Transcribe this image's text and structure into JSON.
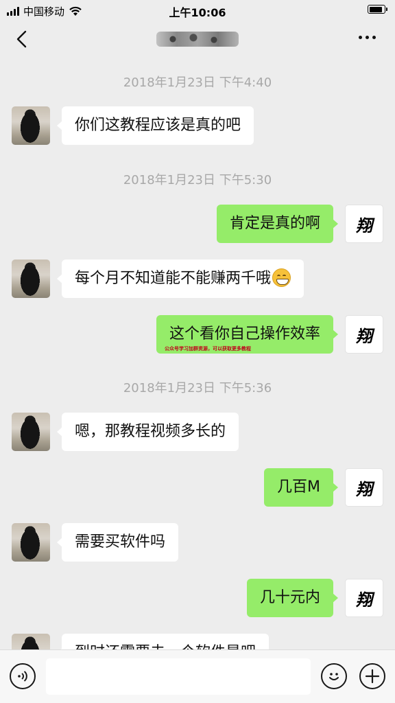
{
  "status_bar": {
    "carrier": "中国移动",
    "time": "上午10:06",
    "battery_level": 0.9
  },
  "nav": {
    "back_icon": "chevron-left-icon",
    "more_icon": "ellipsis-icon"
  },
  "messages": [
    {
      "type": "timestamp",
      "text": "2018年1月23日 下午4:40"
    },
    {
      "type": "msg",
      "side": "left",
      "text": "你们这教程应该是真的吧"
    },
    {
      "type": "timestamp",
      "text": "2018年1月23日 下午5:30"
    },
    {
      "type": "msg",
      "side": "right",
      "text": "肯定是真的啊"
    },
    {
      "type": "msg",
      "side": "left",
      "text": "每个月不知道能不能赚两千哦",
      "emoji": "grin-emoji"
    },
    {
      "type": "msg",
      "side": "right",
      "text": "这个看你自己操作效率",
      "overlay": "公众号学习加群资源，可以获取更多教程"
    },
    {
      "type": "timestamp",
      "text": "2018年1月23日 下午5:36"
    },
    {
      "type": "msg",
      "side": "left",
      "text": "嗯，那教程视频多长的"
    },
    {
      "type": "msg",
      "side": "right",
      "text": "几百M"
    },
    {
      "type": "msg",
      "side": "left",
      "text": "需要买软件吗"
    },
    {
      "type": "msg",
      "side": "right",
      "text": "几十元内"
    },
    {
      "type": "msg",
      "side": "left",
      "text": "到时还需要去一个软件是吧"
    }
  ],
  "my_avatar_text": "翔",
  "input_bar": {
    "voice_icon": "voice-icon",
    "emoji_icon": "smiley-icon",
    "plus_icon": "plus-icon",
    "input_value": ""
  }
}
